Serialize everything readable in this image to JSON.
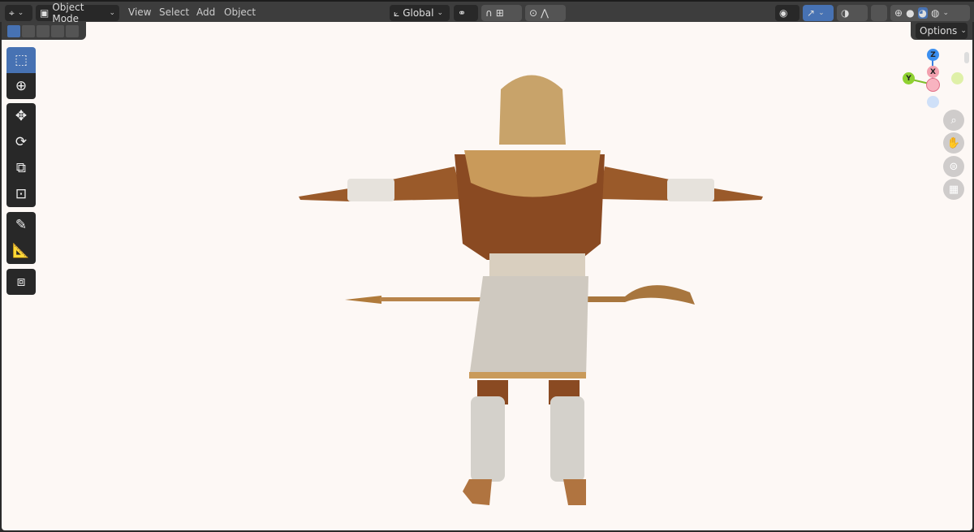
{
  "header": {
    "mode": "Object Mode",
    "menus": [
      "View",
      "Select",
      "Add",
      "Object"
    ],
    "transform_orientation": "Global",
    "options_label": "Options"
  },
  "gizmo": {
    "z": "Z",
    "x": "X",
    "y": "Y"
  },
  "colors": {
    "accent": "#4772b3",
    "header": "#3d3d3d",
    "viewport": "#fdf8f5"
  }
}
